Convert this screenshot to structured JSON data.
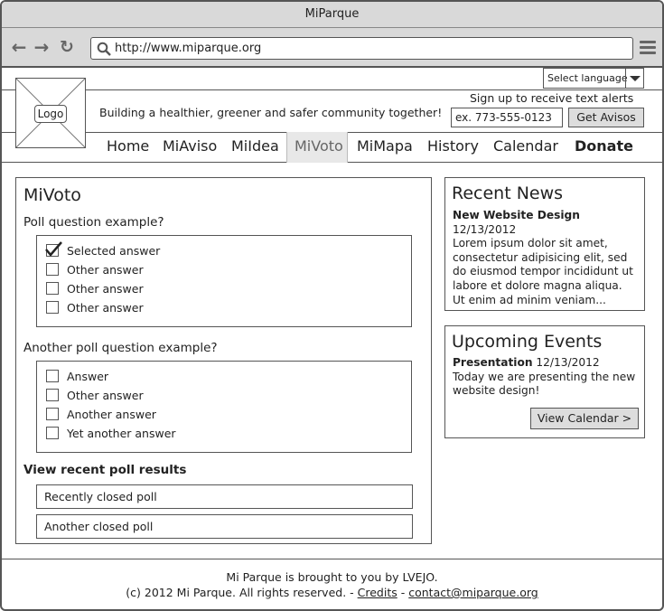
{
  "window": {
    "title": "MiParque"
  },
  "browser": {
    "url": "http://www.miparque.org"
  },
  "language": {
    "selected": "Select language"
  },
  "header": {
    "logo_label": "Logo",
    "tagline": "Building a healthier, greener and safer community together!",
    "alerts": {
      "title": "Sign up to receive text alerts",
      "phone_placeholder": "ex. 773-555-0123",
      "button": "Get Avisos"
    }
  },
  "nav": {
    "items": [
      "Home",
      "MiAviso",
      "MiIdea",
      "MiVoto",
      "MiMapa",
      "History",
      "Calendar",
      "Donate"
    ],
    "active": "MiVoto"
  },
  "mivoto": {
    "title": "MiVoto",
    "poll1": {
      "question": "Poll question example?",
      "options": [
        {
          "label": "Selected answer",
          "checked": true
        },
        {
          "label": "Other answer",
          "checked": false
        },
        {
          "label": "Other answer",
          "checked": false
        },
        {
          "label": "Other answer",
          "checked": false
        }
      ]
    },
    "poll2": {
      "question": "Another poll question example?",
      "options": [
        {
          "label": "Answer",
          "checked": false
        },
        {
          "label": "Other answer",
          "checked": false
        },
        {
          "label": "Another answer",
          "checked": false
        },
        {
          "label": "Yet another answer",
          "checked": false
        }
      ]
    },
    "results": {
      "title": "View recent poll results",
      "items": [
        "Recently closed poll",
        "Another closed poll"
      ]
    }
  },
  "news": {
    "title": "Recent News",
    "headline": "New Website Design",
    "date": "12/13/2012",
    "body": "Lorem ipsum dolor sit amet, consectetur adipisicing elit, sed do eiusmod tempor incididunt ut labore et dolore magna aliqua. Ut enim ad minim veniam..."
  },
  "events": {
    "title": "Upcoming Events",
    "headline": "Presentation",
    "date": "12/13/2012",
    "body": "Today we are presenting the new website design!",
    "button": "View Calendar >"
  },
  "footer": {
    "line1": "Mi Parque is brought to you by LVEJO.",
    "copyright": "(c) 2012 Mi Parque. All rights reserved. -",
    "credits": "Credits",
    "sep": "-",
    "contact": "contact@miparque.org"
  }
}
